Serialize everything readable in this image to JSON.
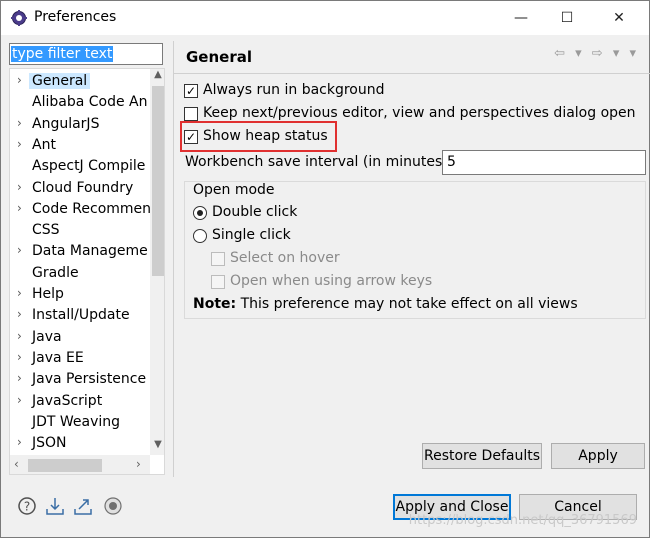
{
  "window": {
    "title": "Preferences",
    "icon": "eclipse-gear-icon",
    "controls": {
      "minimize": "—",
      "maximize": "☐",
      "close": "✕"
    }
  },
  "filter": {
    "value": "type filter text"
  },
  "tree": {
    "items": [
      {
        "label": "General",
        "expandable": true,
        "selected": true
      },
      {
        "label": "Alibaba Code An",
        "expandable": false
      },
      {
        "label": "AngularJS",
        "expandable": true
      },
      {
        "label": "Ant",
        "expandable": true
      },
      {
        "label": "AspectJ Compile",
        "expandable": false
      },
      {
        "label": "Cloud Foundry",
        "expandable": true
      },
      {
        "label": "Code Recommen",
        "expandable": true
      },
      {
        "label": "CSS",
        "expandable": false
      },
      {
        "label": "Data Manageme",
        "expandable": true
      },
      {
        "label": "Gradle",
        "expandable": false
      },
      {
        "label": "Help",
        "expandable": true
      },
      {
        "label": "Install/Update",
        "expandable": true
      },
      {
        "label": "Java",
        "expandable": true
      },
      {
        "label": "Java EE",
        "expandable": true
      },
      {
        "label": "Java Persistence",
        "expandable": true
      },
      {
        "label": "JavaScript",
        "expandable": true
      },
      {
        "label": "JDT Weaving",
        "expandable": false
      },
      {
        "label": "JSON",
        "expandable": true
      }
    ]
  },
  "page": {
    "title": "General",
    "nav_icons": "⇦ ▾ ⇨ ▾ ▾",
    "options": [
      {
        "label": "Always run in background",
        "checked": true
      },
      {
        "label": "Keep next/previous editor, view and perspectives dialog open",
        "checked": false
      },
      {
        "label": "Show heap status",
        "checked": true
      }
    ],
    "interval": {
      "label": "Workbench save interval (in minutes):",
      "value": "5"
    },
    "open_mode": {
      "title": "Open mode",
      "double_click": "Double click",
      "single_click": "Single click",
      "select_on_hover": "Select on hover",
      "open_arrow_keys": "Open when using arrow keys",
      "selected": "double_click"
    },
    "note": {
      "bold": "Note:",
      "text": " This preference may not take effect on all views"
    }
  },
  "buttons": {
    "restore": "Restore Defaults",
    "apply": "Apply",
    "apply_close": "Apply and Close",
    "cancel": "Cancel"
  },
  "footer_icons": [
    "help-icon",
    "import-icon",
    "export-icon",
    "record-icon"
  ],
  "watermark": "https://blog.csdn.net/qq_36791569"
}
